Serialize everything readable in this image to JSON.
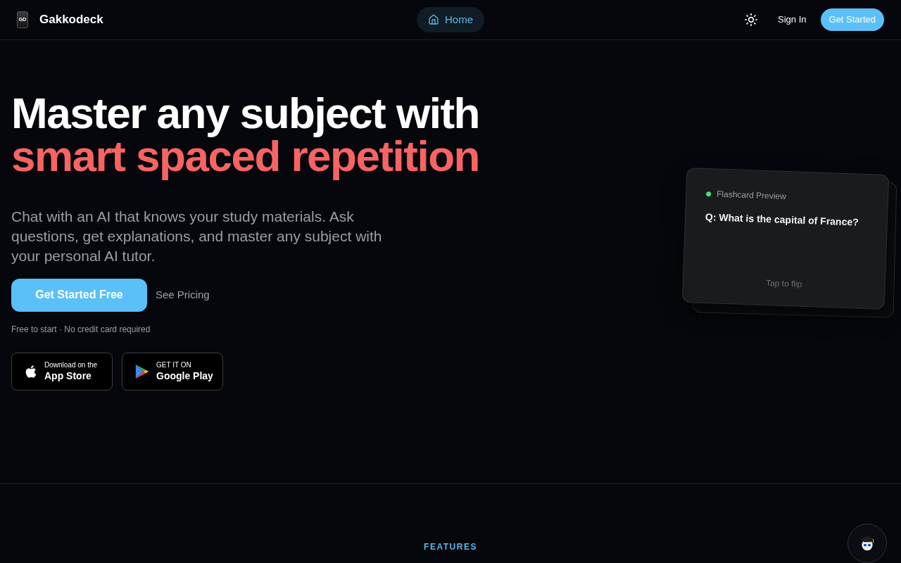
{
  "header": {
    "logo_text": "GD",
    "brand": "Gakkodeck",
    "nav": [
      {
        "label": "Home",
        "selected": true
      }
    ],
    "sign_in": "Sign In",
    "cta": "Get Started"
  },
  "hero": {
    "title_line_1": "Master any subject with",
    "title_line_2": "smart spaced repetition",
    "description": "Chat with an AI that knows your study materials. Ask questions, get explanations, and master any subject with your personal AI tutor.",
    "primary_button": "Get Started Free",
    "secondary_link": "See Pricing",
    "note": "Free to start · No credit card required",
    "store_badges": [
      {
        "kind": "apple",
        "small": "Download on the",
        "large": "App Store"
      },
      {
        "kind": "google",
        "small": "GET IT ON",
        "large": "Google Play"
      }
    ]
  },
  "flashcard": {
    "label": "Flashcard Preview",
    "question": "Q: What is the capital of France?",
    "hint": "Tap to flip"
  },
  "features": {
    "eyebrow": "FEATURES"
  }
}
